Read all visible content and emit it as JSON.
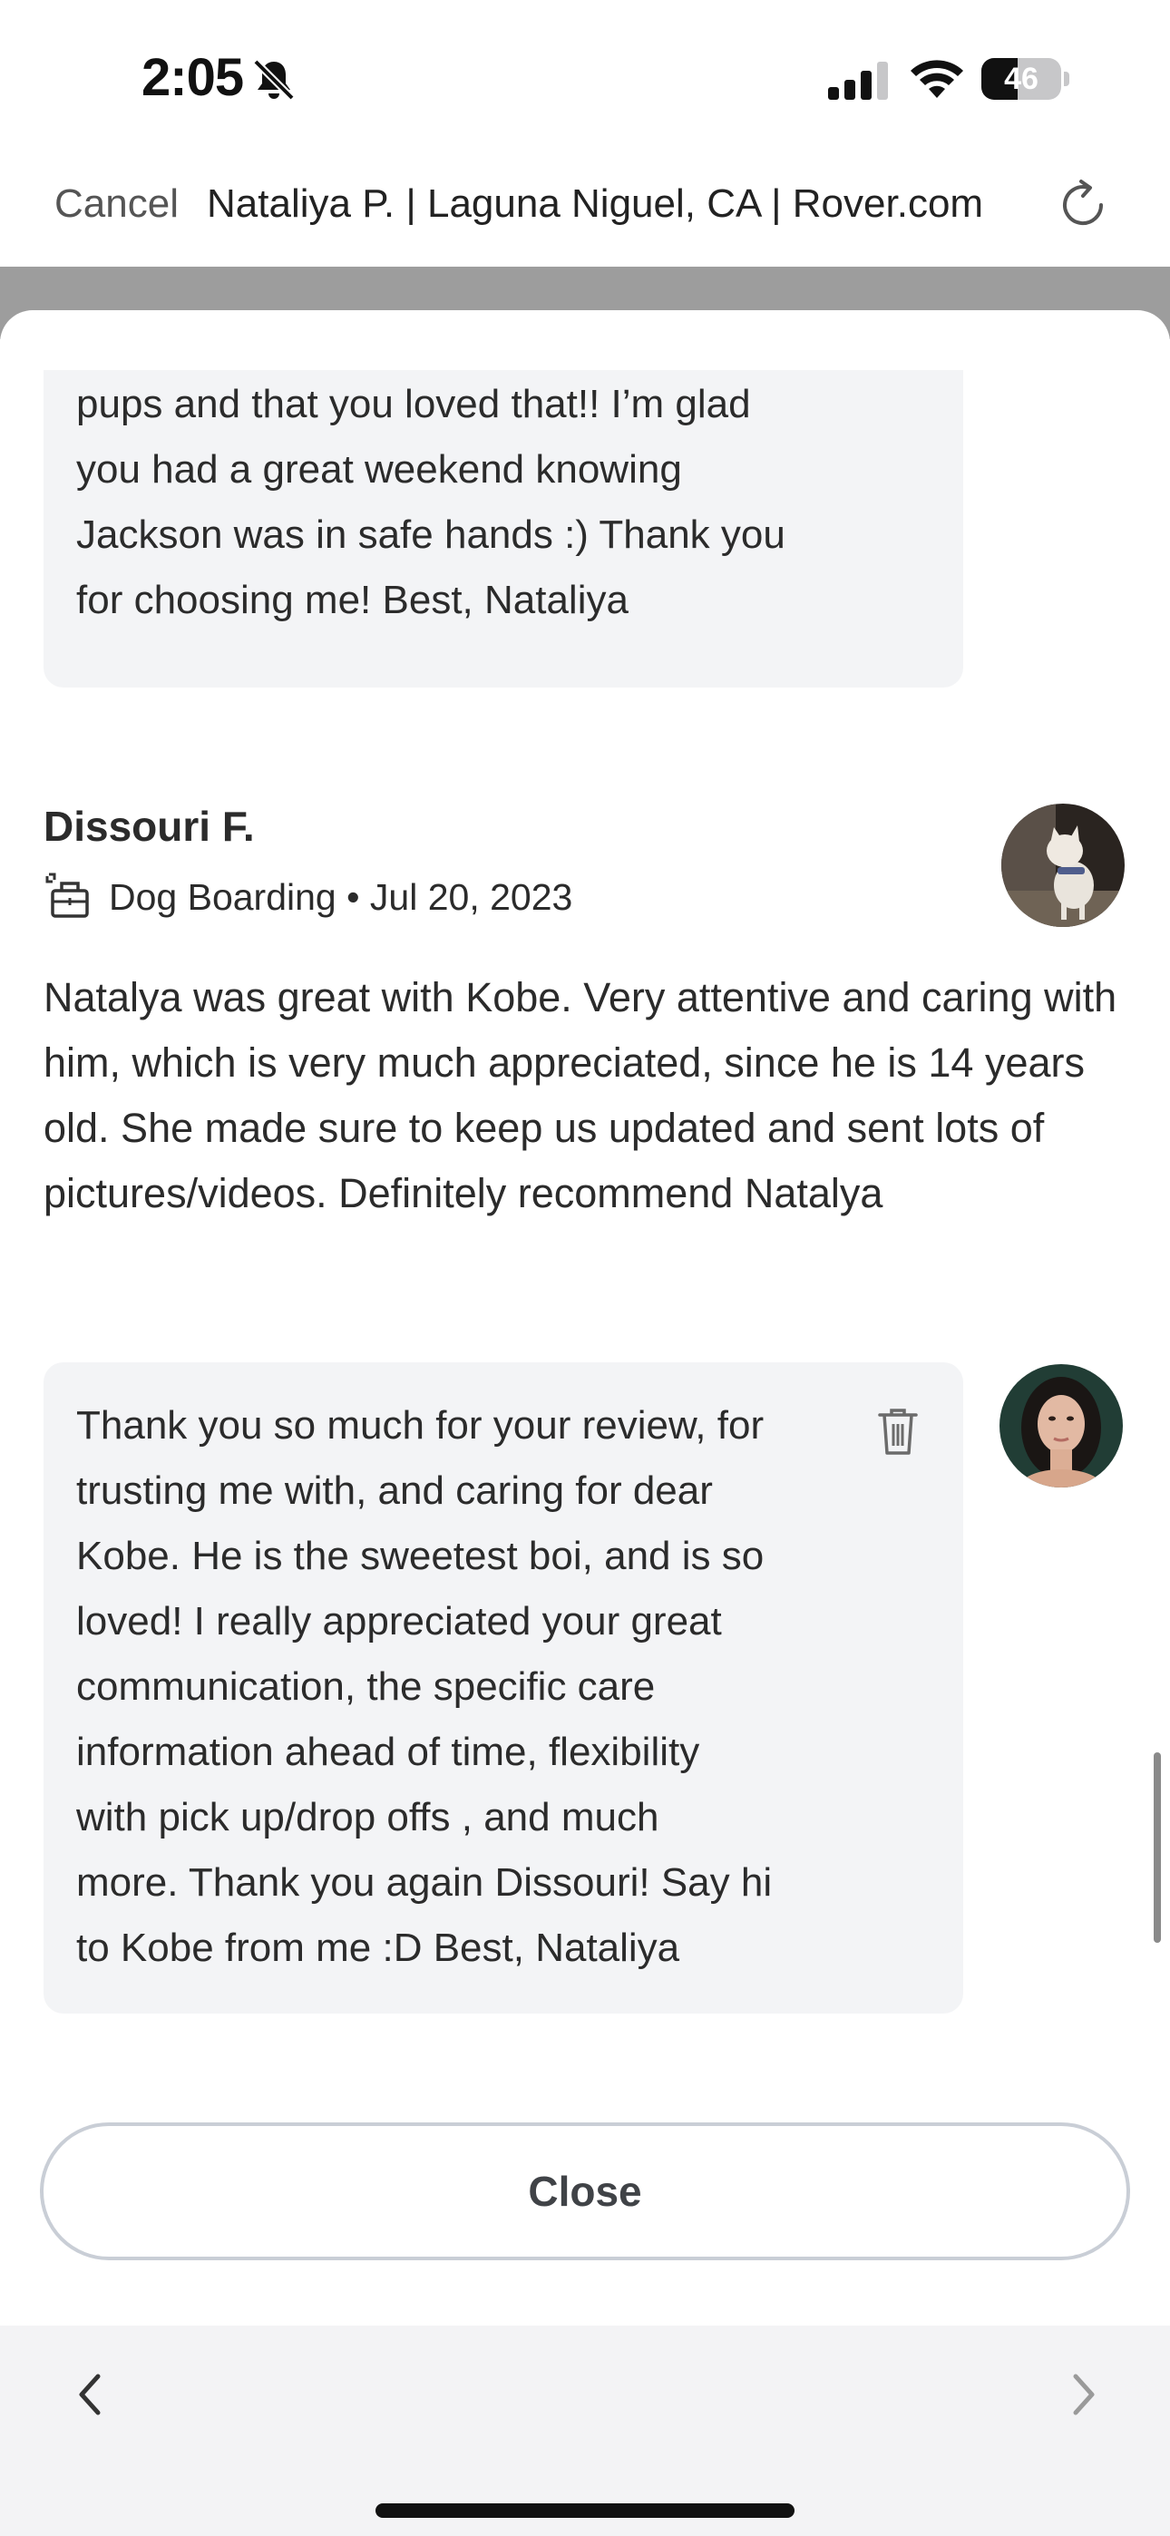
{
  "status_bar": {
    "time": "2:05",
    "battery": "46",
    "battery_level": 0.46,
    "icons": [
      "bell-slash-icon",
      "cellular-signal-icon",
      "wifi-icon",
      "battery-icon"
    ]
  },
  "browser": {
    "cancel_label": "Cancel",
    "title": "Nataliya P. | Laguna Niguel, CA | Rover.com",
    "reload_icon": "reload-icon"
  },
  "previous_reply": {
    "lines": [
      "pups and that you loved that!! I’m glad",
      "you had a great weekend knowing",
      "Jackson was in safe hands :) Thank you",
      "for choosing me! Best, Nataliya"
    ]
  },
  "review": {
    "reviewer_name": "Dissouri F.",
    "service": "Dog Boarding",
    "separator": "•",
    "date": "Jul 20, 2023",
    "service_icon": "dog-boarding-icon",
    "text": "Natalya was great with Kobe. Very attentive and caring with him, which is very much appreciated, since he is 14 years old. She made sure to keep us updated and sent lots of pictures/videos. Definitely recommend Natalya"
  },
  "reply": {
    "lines": [
      "Thank you so much for your review, for",
      "trusting me with, and caring for dear",
      "Kobe. He is the sweetest boi, and is so",
      "loved! I really appreciated your great",
      "communication, the specific care",
      "information ahead of time, flexibility",
      "with pick up/drop offs , and much",
      "more. Thank you again Dissouri! Say hi",
      "to Kobe from me :D Best, Nataliya"
    ],
    "delete_icon": "trash-icon"
  },
  "close_label": "Close",
  "bottom_nav": {
    "back_icon": "chevron-left-icon",
    "forward_icon": "chevron-right-icon"
  },
  "colors": {
    "bubble_bg": "#f3f4f6",
    "text": "#2b2b2b",
    "backdrop": "#9d9d9d",
    "button_border": "#c9ced6"
  }
}
